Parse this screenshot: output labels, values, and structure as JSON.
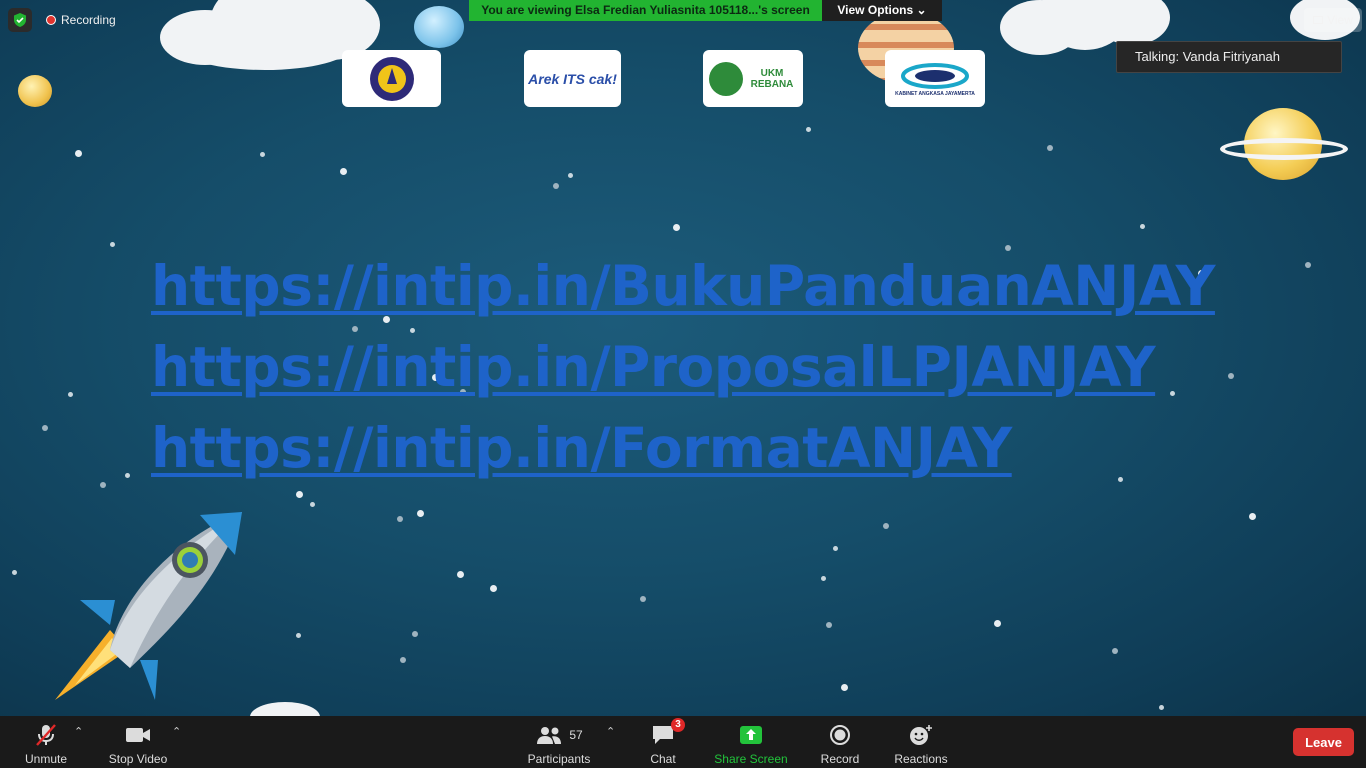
{
  "header": {
    "recording_label": "Recording",
    "viewing_banner": "You are viewing Elsa Fredian Yuliasnita 105118...'s screen",
    "view_options_label": "View Options",
    "view_button_label": "View",
    "talking_label": "Talking: Vanda Fitriyanah"
  },
  "slide": {
    "logos": [
      {
        "text": ""
      },
      {
        "text": "Arek ITS cak!"
      },
      {
        "text": "UKM REBANA"
      },
      {
        "text": "KABINET ANGKASA JAYAMERTA"
      }
    ],
    "links": [
      "https://intip.in/BukuPanduanANJAY",
      "https://intip.in/ProposalLPJANJAY",
      "https://intip.in/FormatANJAY"
    ]
  },
  "toolbar": {
    "unmute_label": "Unmute",
    "stop_video_label": "Stop Video",
    "participants_label": "Participants",
    "participants_count": "57",
    "chat_label": "Chat",
    "chat_badge": "3",
    "share_screen_label": "Share Screen",
    "record_label": "Record",
    "reactions_label": "Reactions",
    "leave_label": "Leave"
  },
  "colors": {
    "link": "#1e63c9",
    "banner_green": "#22b431",
    "leave_red": "#d6322f",
    "share_green": "#22c33b"
  }
}
